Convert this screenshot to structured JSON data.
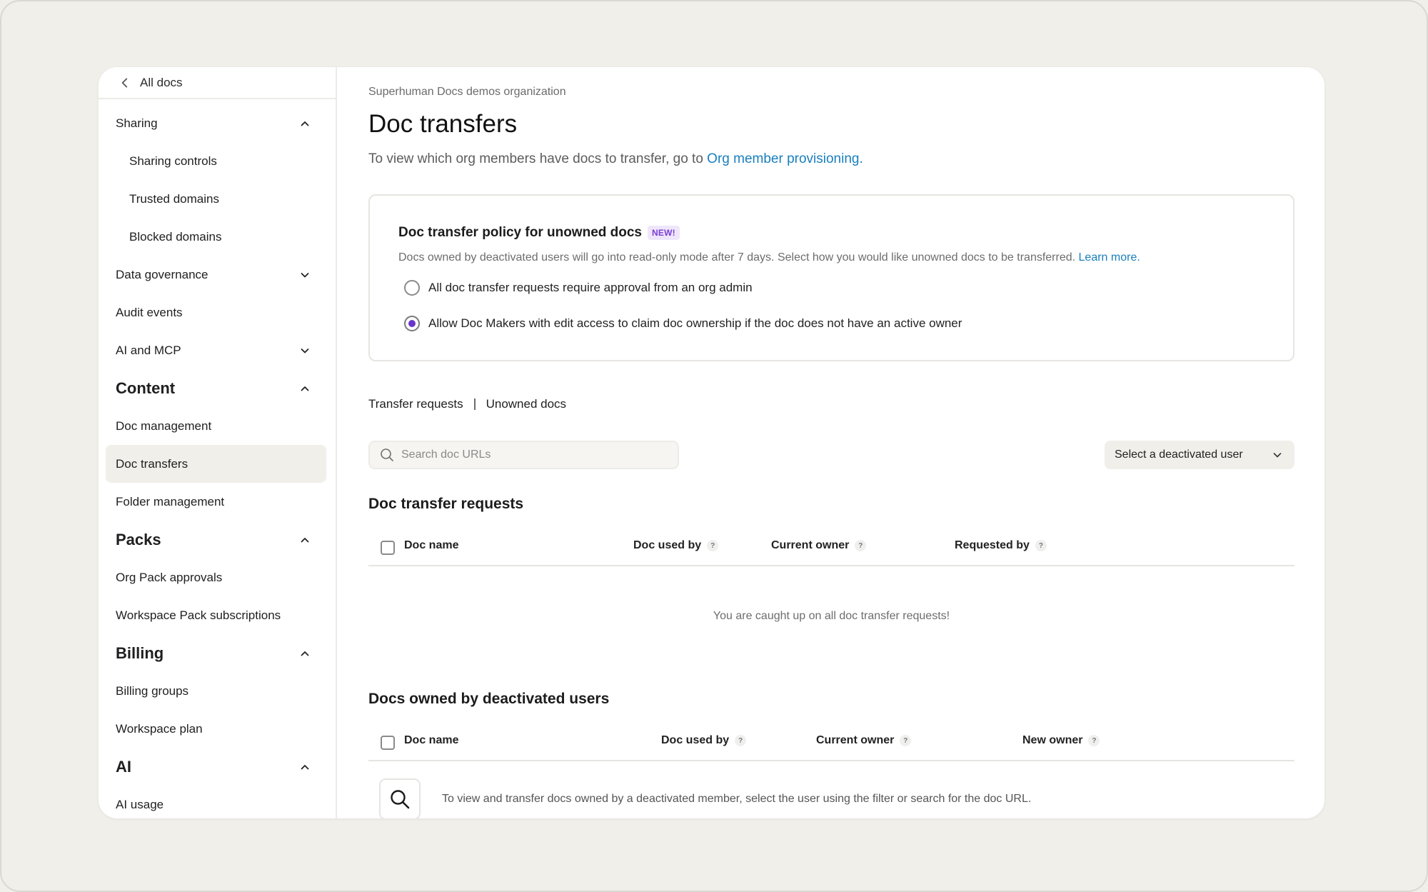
{
  "sidebar": {
    "back_label": "All docs",
    "items": [
      {
        "label": "Sharing",
        "kind": "group",
        "toggle": "up"
      },
      {
        "label": "Sharing controls",
        "kind": "sub"
      },
      {
        "label": "Trusted domains",
        "kind": "sub"
      },
      {
        "label": "Blocked domains",
        "kind": "sub"
      },
      {
        "label": "Data governance",
        "kind": "group",
        "toggle": "down"
      },
      {
        "label": "Audit events",
        "kind": "item"
      },
      {
        "label": "AI and MCP",
        "kind": "group",
        "toggle": "down"
      },
      {
        "label": "Content",
        "kind": "section",
        "toggle": "up"
      },
      {
        "label": "Doc management",
        "kind": "item"
      },
      {
        "label": "Doc transfers",
        "kind": "item",
        "active": true
      },
      {
        "label": "Folder management",
        "kind": "item"
      },
      {
        "label": "Packs",
        "kind": "section",
        "toggle": "up"
      },
      {
        "label": "Org Pack approvals",
        "kind": "item"
      },
      {
        "label": "Workspace Pack subscriptions",
        "kind": "item"
      },
      {
        "label": "Billing",
        "kind": "section",
        "toggle": "up"
      },
      {
        "label": "Billing groups",
        "kind": "item"
      },
      {
        "label": "Workspace plan",
        "kind": "item"
      },
      {
        "label": "AI",
        "kind": "section",
        "toggle": "up"
      },
      {
        "label": "AI usage",
        "kind": "item"
      }
    ]
  },
  "header": {
    "org_name": "Superhuman Docs demos organization",
    "title": "Doc transfers",
    "intro_text": "To view which org members have docs to transfer, go to ",
    "intro_link": "Org member provisioning."
  },
  "policy": {
    "title": "Doc transfer policy for unowned docs",
    "badge": "NEW!",
    "description": "Docs owned by deactivated users will go into read-only mode after 7 days. Select how you would like unowned docs to be transferred. ",
    "learn_more": "Learn more.",
    "options": [
      {
        "label": "All doc transfer requests require approval from an org admin",
        "checked": false
      },
      {
        "label": "Allow Doc Makers with edit access to claim doc ownership if the doc does not have an active owner",
        "checked": true
      }
    ]
  },
  "tabs": [
    "Transfer requests",
    "Unowned docs"
  ],
  "search": {
    "placeholder": "Search doc URLs"
  },
  "user_filter": {
    "label": "Select a deactivated user"
  },
  "requests_table": {
    "title": "Doc transfer requests",
    "columns": [
      "Doc name",
      "Doc used by",
      "Current owner",
      "Requested by"
    ],
    "help_mark": "?",
    "empty_message": "You are caught up on all doc transfer requests!"
  },
  "deactivated_table": {
    "title": "Docs owned by deactivated users",
    "columns": [
      "Doc name",
      "Doc used by",
      "Current owner",
      "New owner"
    ],
    "help_mark": "?",
    "hint": "To view and transfer docs owned by a deactivated member, select the user using the filter or search for the doc URL."
  },
  "colors": {
    "accent_link": "#1a7fbd",
    "radio_selected": "#6a35c9",
    "badge_bg": "#efe6fb",
    "badge_text": "#7b3fd4",
    "active_nav_bg": "#f0efea"
  }
}
